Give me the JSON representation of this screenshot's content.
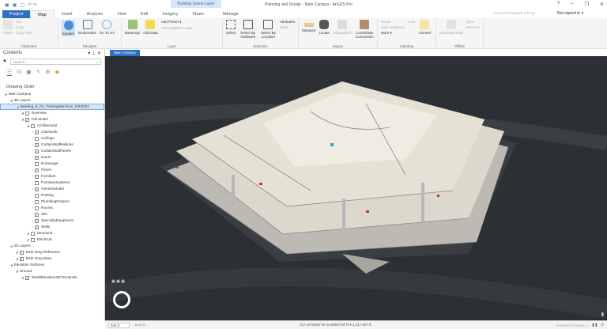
{
  "app": {
    "title": "Planning and Design - Main Campus - ArcGIS Pro",
    "context_tab": "Building Scene Layer",
    "window_controls": [
      "?",
      "–",
      "❐",
      "✕"
    ]
  },
  "tabs": [
    "Project",
    "Map",
    "Insert",
    "Analysis",
    "View",
    "Edit",
    "Imagery",
    "Share",
    "Manage"
  ],
  "search": {
    "placeholder": "Command Search (Alt+Q)"
  },
  "user": {
    "label": "Not signed in ▾"
  },
  "ribbon": {
    "clipboard": {
      "label": "Clipboard",
      "paste": "Paste",
      "cut": "Cut",
      "copy": "Copy",
      "copy_path": "Copy Path"
    },
    "navigate": {
      "label": "Navigate",
      "explore": "Explore",
      "bookmarks": "Bookmarks",
      "goto": "Go To XY"
    },
    "layer": {
      "label": "Layer",
      "basemap": "Basemap",
      "add_data": "Add Data",
      "add_preset": "Add Preset ▾",
      "add_graphics": "Add Graphics Layer"
    },
    "selection": {
      "label": "Selection",
      "select": "Select",
      "by_attr": "Select By Attributes",
      "by_loc": "Select By Location",
      "attributes": "Attributes",
      "clear": "Clear"
    },
    "inquiry": {
      "label": "Inquiry",
      "measure": "Measure",
      "locate": "Locate",
      "infographics": "Infographics",
      "coord": "Coordinate Conversion"
    },
    "labeling": {
      "label": "Labeling",
      "pause": "Pause",
      "lock": "Lock",
      "view_unplaced": "View Unplaced",
      "more": "More ▾",
      "convert": "Convert"
    },
    "offline": {
      "label": "Offline",
      "download": "Download Map",
      "sync": "Sync",
      "remove": "Remove"
    }
  },
  "contents": {
    "title": "Contents",
    "search_placeholder": "Search",
    "drawing_order": "Drawing Order",
    "tree": [
      {
        "label": "Main Campus",
        "level": 0,
        "cb": null
      },
      {
        "label": "3D Layers",
        "level": 1,
        "cb": null
      },
      {
        "label": "Building_E_for_TrainingServices_Feb2022",
        "level": 2,
        "cb": null,
        "selected": true
      },
      {
        "label": "Overview",
        "level": 3,
        "cb": false
      },
      {
        "label": "Full Model",
        "level": 3,
        "cb": true
      },
      {
        "label": "Architectural",
        "level": 4,
        "cb": false
      },
      {
        "label": "Casework",
        "level": 5,
        "cb": true
      },
      {
        "label": "Ceilings",
        "level": 5,
        "cb": false
      },
      {
        "label": "CurtainWallMullions",
        "level": 5,
        "cb": true
      },
      {
        "label": "CurtainWallPanels",
        "level": 5,
        "cb": true
      },
      {
        "label": "Doors",
        "level": 5,
        "cb": true
      },
      {
        "label": "Entourage",
        "level": 5,
        "cb": false
      },
      {
        "label": "Floors",
        "level": 5,
        "cb": true
      },
      {
        "label": "Furniture",
        "level": 5,
        "cb": true
      },
      {
        "label": "FurnitureSystems",
        "level": 5,
        "cb": false
      },
      {
        "label": "GenericModel",
        "level": 5,
        "cb": true
      },
      {
        "label": "Parking",
        "level": 5,
        "cb": false
      },
      {
        "label": "PlumbingFixtures",
        "level": 5,
        "cb": false
      },
      {
        "label": "Rooms",
        "level": 5,
        "cb": false
      },
      {
        "label": "Site",
        "level": 5,
        "cb": true
      },
      {
        "label": "SpecialtyEquipment",
        "level": 5,
        "cb": true
      },
      {
        "label": "Walls",
        "level": 5,
        "cb": true
      },
      {
        "label": "Structural",
        "level": 4,
        "cb": false
      },
      {
        "label": "Electrical",
        "level": 4,
        "cb": false
      },
      {
        "label": "2D Layers",
        "level": 1,
        "cb": null
      },
      {
        "label": "Dark Gray Reference",
        "level": 2,
        "cb": true
      },
      {
        "label": "Dark Gray Base",
        "level": 2,
        "cb": true
      },
      {
        "label": "Elevation Surfaces",
        "level": 1,
        "cb": null
      },
      {
        "label": "Ground",
        "level": 2,
        "cb": null
      },
      {
        "label": "WorldElevation3D/Terrain3D",
        "level": 3,
        "cb": true
      }
    ]
  },
  "map": {
    "tab": "Main Campus"
  },
  "status": {
    "scale": "545 ft",
    "coords": "117.1974020°W 34.0583719°N ▾ 1,217.807 ft",
    "selected": "Selected Features: 1"
  },
  "colors": {
    "accent": "#2d6fc0",
    "map_bg": "#2c3034"
  }
}
